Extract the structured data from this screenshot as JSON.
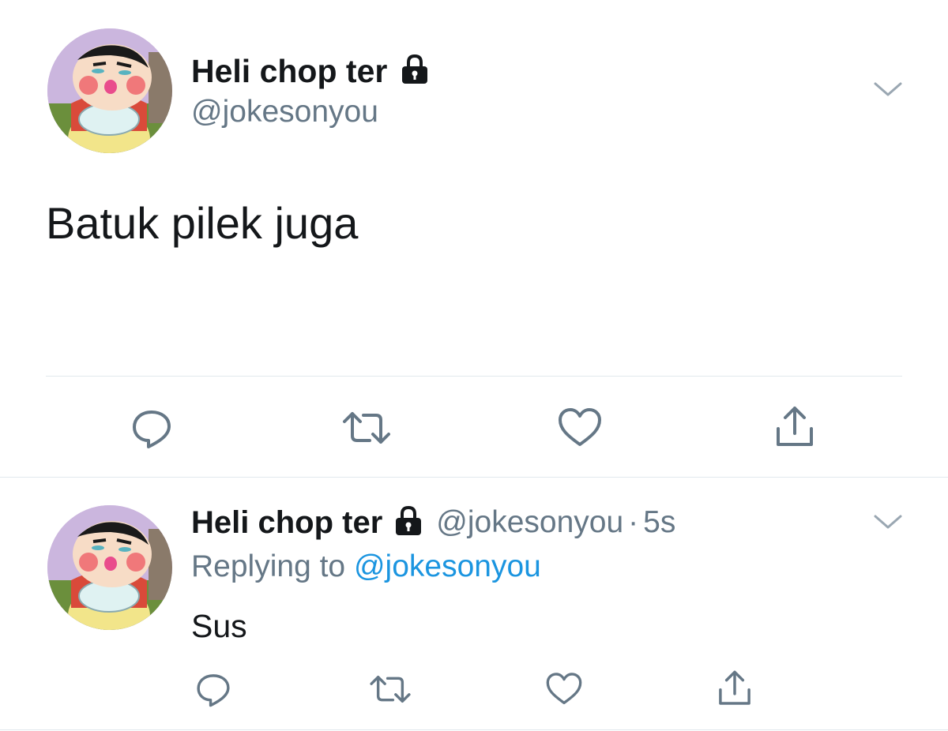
{
  "main_tweet": {
    "display_name": "Heli chop ter",
    "handle": "@jokesonyou",
    "text": "Batuk pilek juga",
    "avatar_icon": "cartoon-avatar",
    "protected_icon": "lock-icon"
  },
  "reply_tweet": {
    "display_name": "Heli chop ter",
    "handle": "@jokesonyou",
    "separator": "·",
    "time": "5s",
    "replying_prefix": "Replying to",
    "replying_to": "@jokesonyou",
    "text": "Sus",
    "avatar_icon": "cartoon-avatar",
    "protected_icon": "lock-icon"
  },
  "actions": [
    "reply-icon",
    "retweet-icon",
    "like-icon",
    "share-icon"
  ],
  "colors": {
    "text": "#14171a",
    "secondary": "#657786",
    "link": "#1b95e0",
    "divider": "#e1e8ed"
  }
}
